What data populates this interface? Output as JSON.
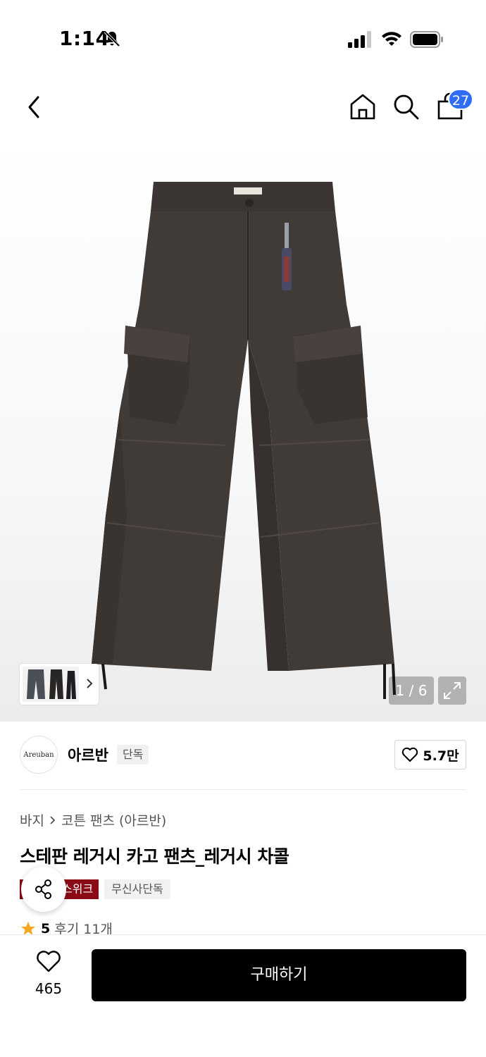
{
  "status_bar": {
    "time": "1:14"
  },
  "nav": {
    "cart_count": "27"
  },
  "gallery": {
    "counter": "1 / 6"
  },
  "brand": {
    "logo_text": "Areuban",
    "name": "아르반",
    "tag": "단독",
    "likes": "5.7만"
  },
  "product": {
    "breadcrumb": [
      "바지",
      "코튼 팬츠 (아르반)"
    ],
    "title": "스테판 레거시 카고 팬츠_레거시 차콜",
    "badges": [
      "스위크",
      "무신사단독"
    ],
    "rating": "5",
    "reviews": "후기 11개"
  },
  "bottom_bar": {
    "wish_count": "465",
    "buy_label": "구매하기"
  },
  "colors": {
    "badge_red": "#8a0b15",
    "cart_badge": "#2f6df6",
    "star": "#f5a623",
    "pants": "#3d3835"
  }
}
